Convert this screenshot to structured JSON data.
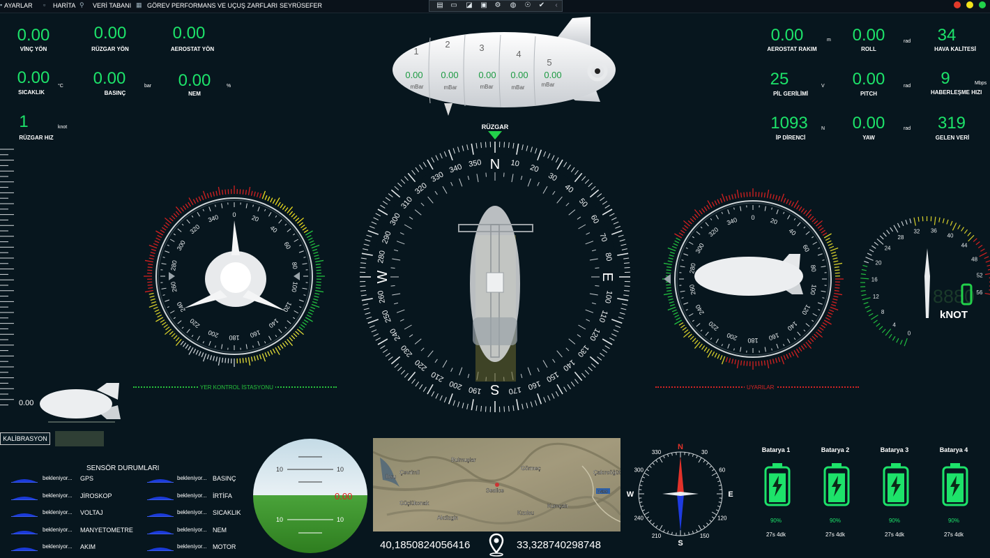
{
  "menu": {
    "items": [
      "AYARLAR",
      "HARİTA",
      "VERİ TABANI",
      "GÖREV PERFORMANS VE UÇUŞ ZARFLARI",
      "SEYRÜSEFER"
    ]
  },
  "toolbar": {
    "icons": [
      "record-icon",
      "camera-icon",
      "comment-icon",
      "window-icon",
      "settings-icon",
      "telemetry-icon",
      "accessibility-icon",
      "check-icon",
      "chevron-left-icon"
    ]
  },
  "status_lights": {
    "colors": [
      "#e23a2a",
      "#f2e21a",
      "#22d14a"
    ]
  },
  "telemetry_left": [
    {
      "value": "0.00",
      "label": "VİNÇ YÖN",
      "unit": ""
    },
    {
      "value": "0.00",
      "label": "RÜZGAR YÖN",
      "unit": ""
    },
    {
      "value": "0.00",
      "label": "AEROSTAT YÖN",
      "unit": ""
    },
    {
      "value": "0.00",
      "label": "SICAKLIK",
      "unit": "°C"
    },
    {
      "value": "0.00",
      "label": "BASINÇ",
      "unit": "bar"
    },
    {
      "value": "0.00",
      "label": "NEM",
      "unit": "%"
    },
    {
      "value": "1",
      "label": "RÜZGAR HIZ",
      "unit": "knot"
    }
  ],
  "telemetry_right": [
    {
      "value": "0.00",
      "label": "AEROSTAT RAKIM",
      "unit": "m"
    },
    {
      "value": "0.00",
      "label": "ROLL",
      "unit": "rad"
    },
    {
      "value": "34",
      "label": "HAVA KALİTESİ",
      "unit": ""
    },
    {
      "value": "25",
      "label": "PİL GERİLİMİ",
      "unit": "V"
    },
    {
      "value": "0.00",
      "label": "PITCH",
      "unit": "rad"
    },
    {
      "value": "9",
      "label": "HABERLEŞME HIZI",
      "unit": "Mbps"
    },
    {
      "value": "1093",
      "label": "İP DİRENCİ",
      "unit": "N"
    },
    {
      "value": "0.00",
      "label": "YAW",
      "unit": "rad"
    },
    {
      "value": "319",
      "label": "GELEN VERİ",
      "unit": ""
    }
  ],
  "ballonets": [
    {
      "num": "1",
      "value": "0.00",
      "unit": "mBar"
    },
    {
      "num": "2",
      "value": "0.00",
      "unit": "mBar"
    },
    {
      "num": "3",
      "value": "0.00",
      "unit": "mBar"
    },
    {
      "num": "4",
      "value": "0.00",
      "unit": "mBar"
    },
    {
      "num": "5",
      "value": "0.00",
      "unit": "mBar"
    }
  ],
  "compass": {
    "wind_label": "RÜZGAR",
    "cardinals": [
      "N",
      "E",
      "S",
      "W"
    ],
    "heading_deg": 0
  },
  "left_gauge": {
    "ticks": [
      "0",
      "20",
      "40",
      "60",
      "80",
      "100",
      "120",
      "140",
      "160",
      "180",
      "200",
      "220",
      "240",
      "260",
      "280",
      "300",
      "320",
      "340"
    ],
    "label": "YER KONTROL İSTASYONU"
  },
  "right_gauge": {
    "ticks": [
      "0",
      "20",
      "40",
      "60",
      "80",
      "100",
      "120",
      "140",
      "160",
      "180",
      "200",
      "220",
      "240",
      "260",
      "280",
      "300",
      "320",
      "340"
    ],
    "label": "UYARILAR"
  },
  "speed_gauge": {
    "ticks": [
      "0",
      "4",
      "8",
      "12",
      "16",
      "20",
      "24",
      "28",
      "32",
      "36",
      "40",
      "44",
      "48",
      "52",
      "56"
    ],
    "digits": "8880",
    "unit": "kNOT"
  },
  "altitude_scale": {
    "value": "0.00"
  },
  "calibration": {
    "label": "KALİBRASYON"
  },
  "sensors": {
    "title": "SENSÖR DURUMLARI",
    "left": [
      {
        "status": "bekleniyor...",
        "name": "GPS"
      },
      {
        "status": "bekleniyor...",
        "name": "JİROSKOP"
      },
      {
        "status": "bekleniyor...",
        "name": "VOLTAJ"
      },
      {
        "status": "bekleniyor...",
        "name": "MANYETOMETRE"
      },
      {
        "status": "bekleniyor...",
        "name": "AKIM"
      }
    ],
    "right": [
      {
        "status": "bekleniyor...",
        "name": "BASINÇ"
      },
      {
        "status": "bekleniyor...",
        "name": "İRTİFA"
      },
      {
        "status": "bekleniyor...",
        "name": "SICAKLIK"
      },
      {
        "status": "bekleniyor...",
        "name": "NEM"
      },
      {
        "status": "bekleniyor...",
        "name": "MOTOR"
      }
    ]
  },
  "horizon": {
    "pitch_labels": [
      "10",
      "10",
      "10",
      "10"
    ],
    "value": "0.00"
  },
  "map": {
    "places": [
      "Bulmuşlar",
      "Görmeç",
      "Çevrimli",
      "Çakırsöğüt",
      "Ilısu",
      "D400",
      "Seslice",
      "Güçlükonak",
      "Kumçatı",
      "Kızılsu",
      "Akdizgin"
    ],
    "lat": "40,1850824056416",
    "lon": "33,328740298748"
  },
  "mini_compass": {
    "ticks": [
      "330",
      "30",
      "60",
      "300",
      "240",
      "120",
      "210",
      "150"
    ],
    "cardinals": [
      "N",
      "E",
      "S",
      "W"
    ]
  },
  "batteries": [
    {
      "title": "Batarya 1",
      "percent": "90%",
      "time": "27s 4dk",
      "level": 0.9
    },
    {
      "title": "Batarya 2",
      "percent": "90%",
      "time": "27s 4dk",
      "level": 0.9
    },
    {
      "title": "Batarya 3",
      "percent": "90%",
      "time": "27s 4dk",
      "level": 0.9
    },
    {
      "title": "Batarya 4",
      "percent": "90%",
      "time": "27s 4dk",
      "level": 0.9
    }
  ]
}
